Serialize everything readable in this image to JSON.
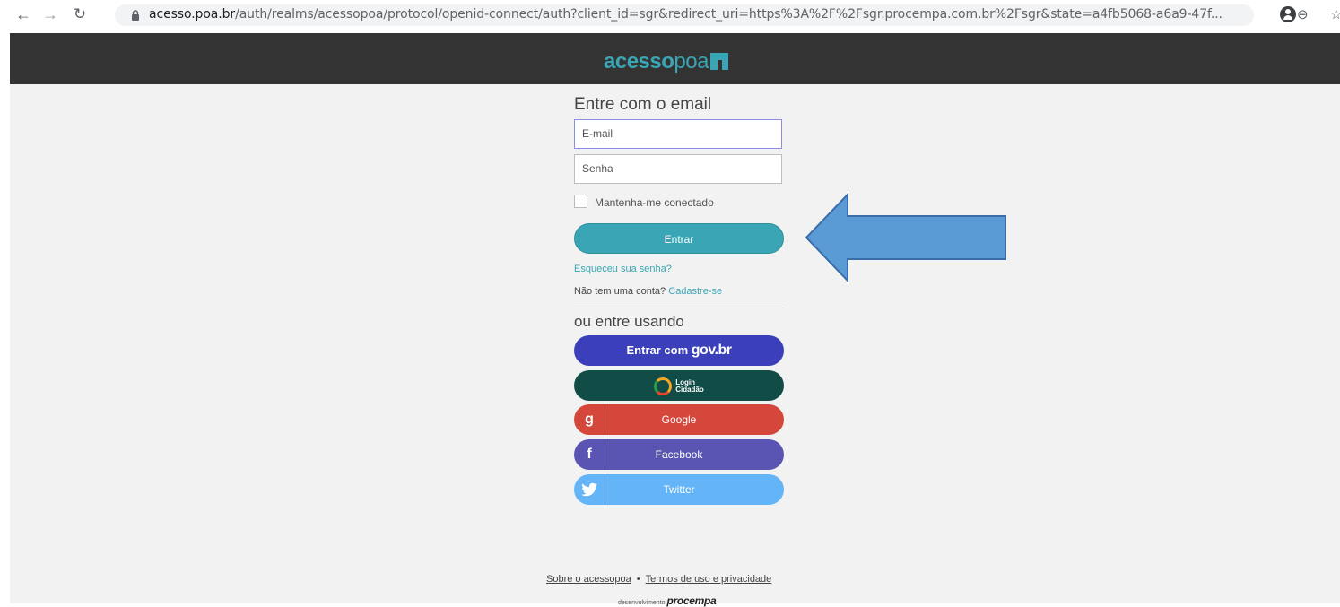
{
  "browser": {
    "url_host": "acesso.poa.br",
    "url_path": "/auth/realms/acessopoa/protocol/openid-connect/auth?client_id=sgr&redirect_uri=https%3A%2F%2Fsgr.procempa.com.br%2Fsgr&state=a4fb5068-a6a9-47f...",
    "icons": [
      "back-arrow-icon",
      "forward-arrow-icon",
      "reload-icon",
      "lock-icon",
      "zoom-icon",
      "star-icon",
      "profile-icon"
    ]
  },
  "header": {
    "logo_bold": "acesso",
    "logo_light": "poa"
  },
  "login": {
    "heading": "Entre com o email",
    "email_placeholder": "E-mail",
    "password_placeholder": "Senha",
    "remember_label": "Mantenha-me conectado",
    "submit_label": "Entrar",
    "forgot_label": "Esqueceu sua senha?",
    "no_account_text": "Não tem uma conta?",
    "register_label": "Cadastre-se"
  },
  "alt_login": {
    "heading": "ou entre usando",
    "govbr_prefix": "Entrar com",
    "govbr_brand": "gov.br",
    "cidadao_line1": "Login",
    "cidadao_line2": "Cidadão",
    "google_icon_glyph": "g",
    "google_label": "Google",
    "facebook_icon_glyph": "f",
    "facebook_label": "Facebook",
    "twitter_label": "Twitter"
  },
  "footer": {
    "about_label": "Sobre o acessopoa",
    "separator": "•",
    "terms_label": "Termos de uso e privacidade",
    "dev_prefix": "desenvolvimento",
    "dev_brand": "procempa"
  },
  "colors": {
    "accent": "#3aa5b5",
    "topbar": "#333333",
    "govbr": "#3b3fb9",
    "cidadao": "#124c47",
    "google": "#d4473a",
    "facebook": "#5a55b2",
    "twitter": "#64b5f7",
    "annotation_arrow": "#5b9bd5"
  }
}
